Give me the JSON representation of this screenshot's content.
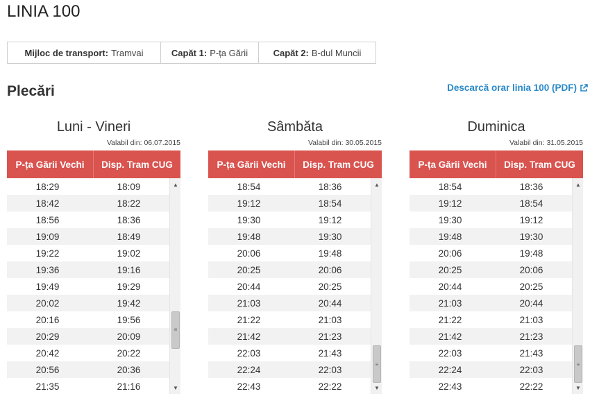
{
  "title": "LINIA 100",
  "info": {
    "transport_label": "Mijloc de transport:",
    "transport_value": "Tramvai",
    "cap1_label": "Capăt 1:",
    "cap1_value": "P-ța Gării",
    "cap2_label": "Capăt 2:",
    "cap2_value": "B-dul Muncii"
  },
  "section_title": "Plecări",
  "pdf_link": "Descarcă orar linia 100 (PDF)",
  "icons": {
    "external_link": "external-link-icon",
    "scroll_up": "up-arrow",
    "scroll_down": "down-arrow",
    "grip": "grip-icon"
  },
  "colors": {
    "header_bg": "#d9534f",
    "link": "#2a88c8",
    "stripe": "#f2f2f2"
  },
  "schedules": [
    {
      "day": "Luni - Vineri",
      "valid": "Valabil din: 06.07.2015",
      "col1": "P-ța Gării Vechi",
      "col2": "Disp. Tram CUG",
      "rows": [
        [
          "18:29",
          "18:09"
        ],
        [
          "18:42",
          "18:22"
        ],
        [
          "18:56",
          "18:36"
        ],
        [
          "19:09",
          "18:49"
        ],
        [
          "19:22",
          "19:02"
        ],
        [
          "19:36",
          "19:16"
        ],
        [
          "19:49",
          "19:29"
        ],
        [
          "20:02",
          "19:42"
        ],
        [
          "20:16",
          "19:56"
        ],
        [
          "20:29",
          "20:09"
        ],
        [
          "20:42",
          "20:22"
        ],
        [
          "20:56",
          "20:36"
        ],
        [
          "21:35",
          "21:16"
        ]
      ],
      "scroll_position": 0.78
    },
    {
      "day": "Sâmbăta",
      "valid": "Valabil din: 30.05.2015",
      "col1": "P-ța Gării Vechi",
      "col2": "Disp. Tram CUG",
      "rows": [
        [
          "18:54",
          "18:36"
        ],
        [
          "19:12",
          "18:54"
        ],
        [
          "19:30",
          "19:12"
        ],
        [
          "19:48",
          "19:30"
        ],
        [
          "20:06",
          "19:48"
        ],
        [
          "20:25",
          "20:06"
        ],
        [
          "20:44",
          "20:25"
        ],
        [
          "21:03",
          "20:44"
        ],
        [
          "21:22",
          "21:03"
        ],
        [
          "21:42",
          "21:23"
        ],
        [
          "22:03",
          "21:43"
        ],
        [
          "22:24",
          "22:03"
        ],
        [
          "22:43",
          "22:22"
        ]
      ],
      "scroll_position": 1.0
    },
    {
      "day": "Duminica",
      "valid": "Valabil din: 31.05.2015",
      "col1": "P-ța Gării Vechi",
      "col2": "Disp. Tram CUG",
      "rows": [
        [
          "18:54",
          "18:36"
        ],
        [
          "19:12",
          "18:54"
        ],
        [
          "19:30",
          "19:12"
        ],
        [
          "19:48",
          "19:30"
        ],
        [
          "20:06",
          "19:48"
        ],
        [
          "20:25",
          "20:06"
        ],
        [
          "20:44",
          "20:25"
        ],
        [
          "21:03",
          "20:44"
        ],
        [
          "21:22",
          "21:03"
        ],
        [
          "21:42",
          "21:23"
        ],
        [
          "22:03",
          "21:43"
        ],
        [
          "22:24",
          "22:03"
        ],
        [
          "22:43",
          "22:22"
        ]
      ],
      "scroll_position": 1.0
    }
  ]
}
